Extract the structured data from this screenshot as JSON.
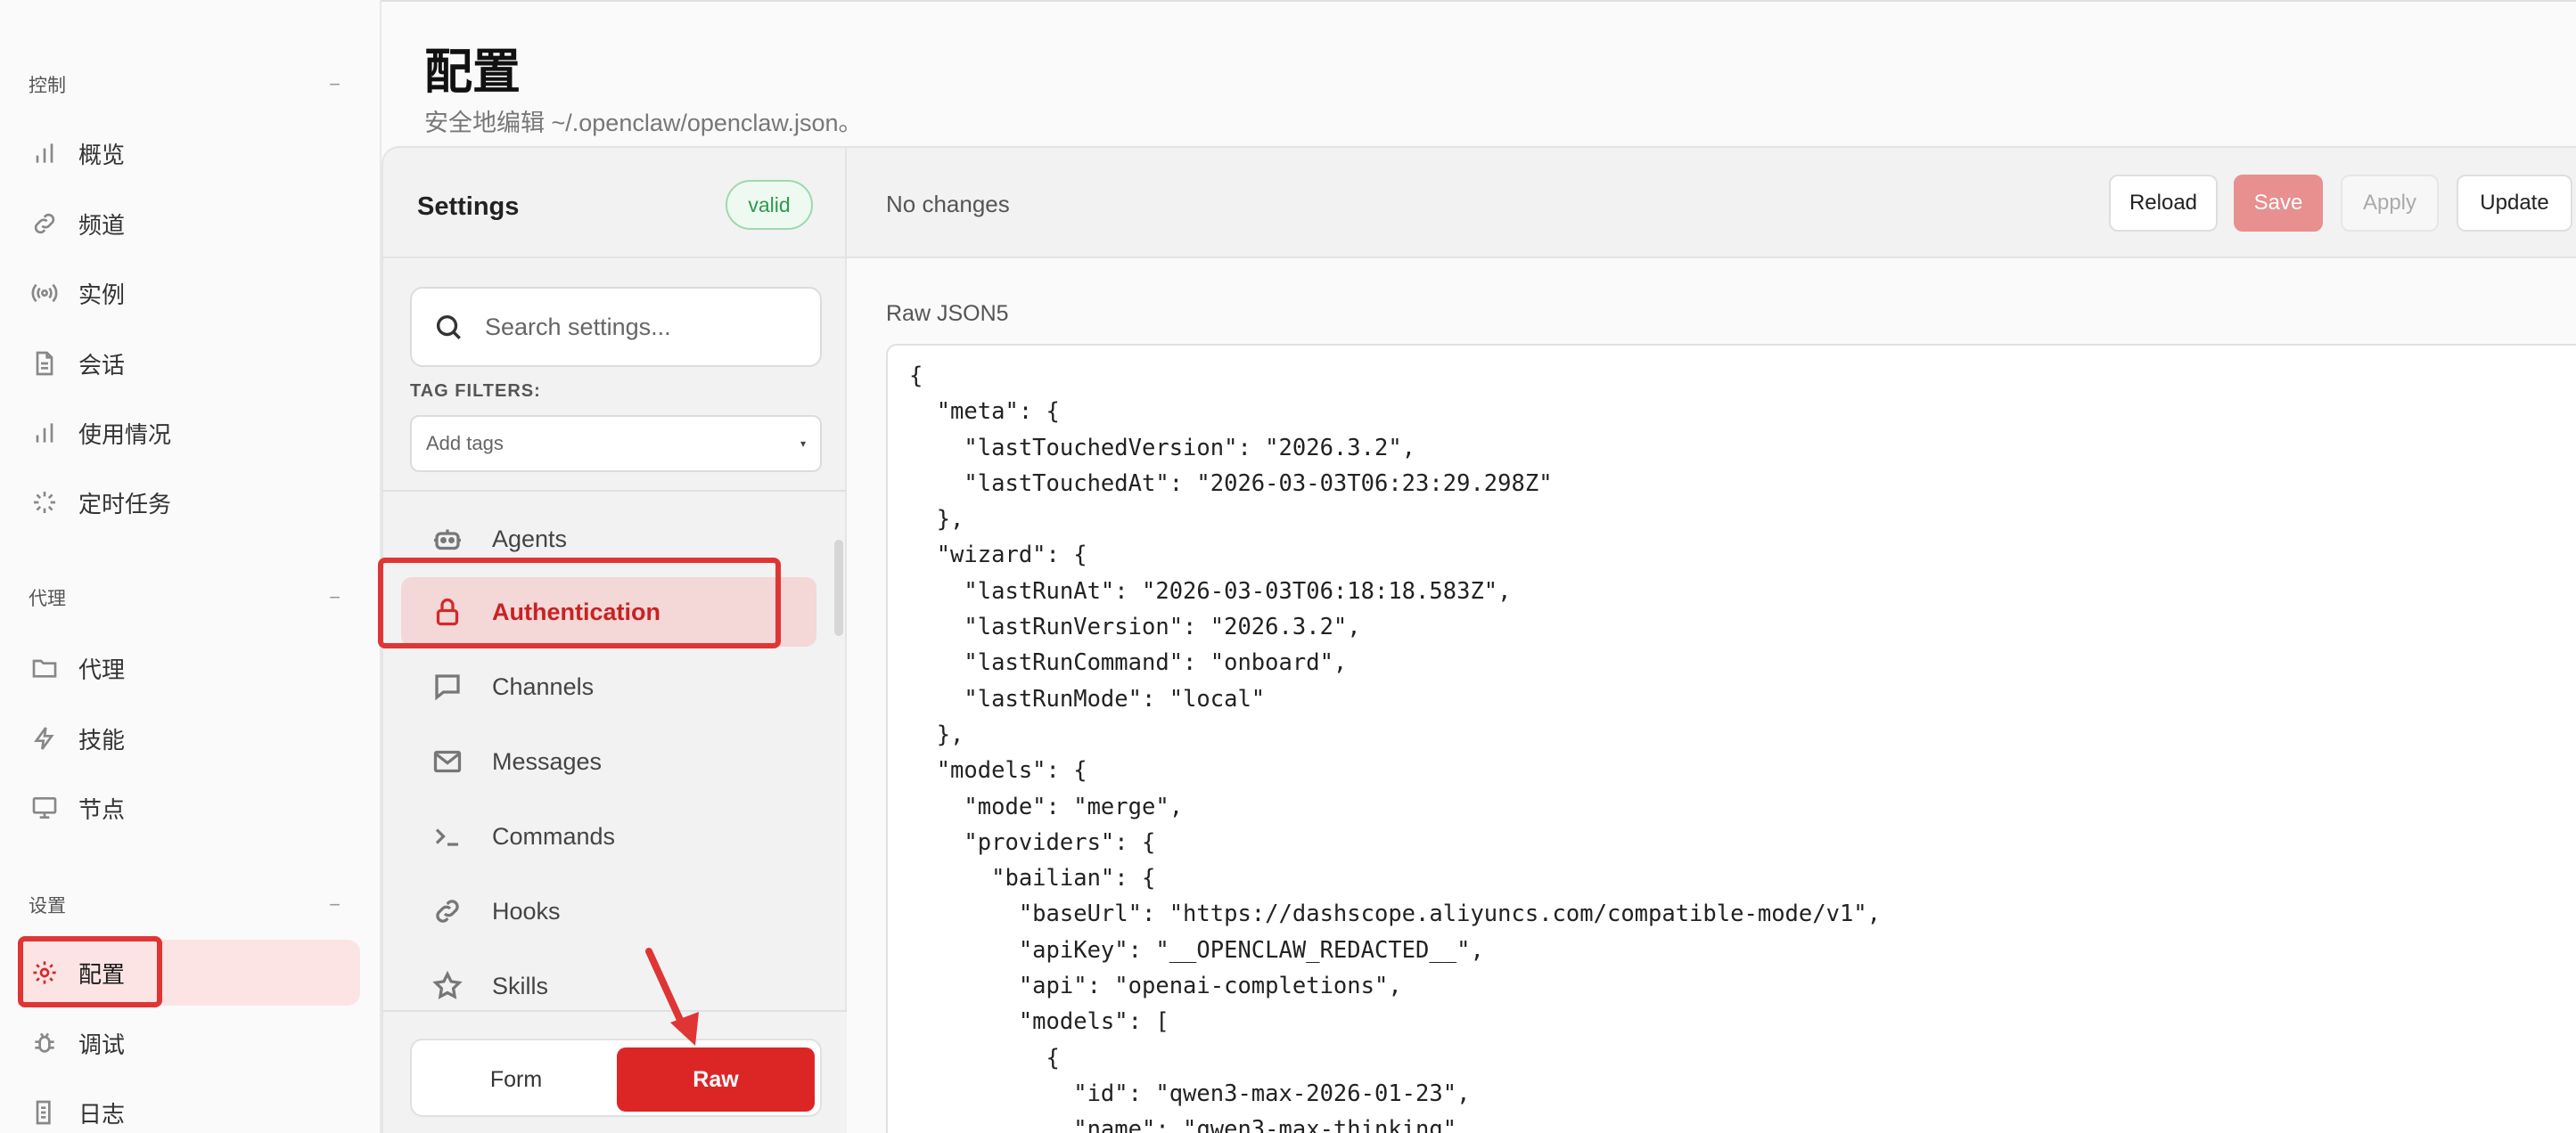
{
  "nav": {
    "groups": [
      {
        "title": "控制",
        "collapse": "−"
      },
      {
        "title": "代理",
        "collapse": "−"
      },
      {
        "title": "设置",
        "collapse": "−"
      }
    ],
    "items": [
      {
        "label": "概览",
        "icon": "bar-chart-icon"
      },
      {
        "label": "频道",
        "icon": "link-icon"
      },
      {
        "label": "实例",
        "icon": "radio-signal-icon"
      },
      {
        "label": "会话",
        "icon": "document-icon"
      },
      {
        "label": "使用情况",
        "icon": "bar-chart-icon"
      },
      {
        "label": "定时任务",
        "icon": "loader-icon"
      },
      {
        "label": "代理",
        "icon": "folder-icon"
      },
      {
        "label": "技能",
        "icon": "lightning-icon"
      },
      {
        "label": "节点",
        "icon": "monitor-icon"
      },
      {
        "label": "配置",
        "icon": "gear-icon",
        "active": true
      },
      {
        "label": "调试",
        "icon": "bug-icon"
      },
      {
        "label": "日志",
        "icon": "log-icon"
      }
    ]
  },
  "header": {
    "title": "配置",
    "subtitle": "安全地编辑 ~/.openclaw/openclaw.json。"
  },
  "settings": {
    "title": "Settings",
    "badge": "valid",
    "search_placeholder": "Search settings...",
    "tag_filters_label": "TAG FILTERS:",
    "tag_placeholder": "Add tags",
    "sections": [
      {
        "label": "Agents",
        "icon": "robot-icon"
      },
      {
        "label": "Authentication",
        "icon": "lock-icon",
        "active": true
      },
      {
        "label": "Channels",
        "icon": "chat-bubble-icon"
      },
      {
        "label": "Messages",
        "icon": "mail-icon"
      },
      {
        "label": "Commands",
        "icon": "terminal-icon"
      },
      {
        "label": "Hooks",
        "icon": "link-icon"
      },
      {
        "label": "Skills",
        "icon": "star-icon"
      }
    ],
    "mode_form": "Form",
    "mode_raw": "Raw"
  },
  "toolbar": {
    "status": "No changes",
    "reload": "Reload",
    "save": "Save",
    "apply": "Apply",
    "update": "Update"
  },
  "editor": {
    "label": "Raw JSON5",
    "content": "{\n  \"meta\": {\n    \"lastTouchedVersion\": \"2026.3.2\",\n    \"lastTouchedAt\": \"2026-03-03T06:23:29.298Z\"\n  },\n  \"wizard\": {\n    \"lastRunAt\": \"2026-03-03T06:18:18.583Z\",\n    \"lastRunVersion\": \"2026.3.2\",\n    \"lastRunCommand\": \"onboard\",\n    \"lastRunMode\": \"local\"\n  },\n  \"models\": {\n    \"mode\": \"merge\",\n    \"providers\": {\n      \"bailian\": {\n        \"baseUrl\": \"https://dashscope.aliyuncs.com/compatible-mode/v1\",\n        \"apiKey\": \"__OPENCLAW_REDACTED__\",\n        \"api\": \"openai-completions\",\n        \"models\": [\n          {\n            \"id\": \"qwen3-max-2026-01-23\",\n            \"name\": \"qwen3-max-thinking\""
  },
  "colors": {
    "accent": "#dc2626",
    "active_bg": "#fce4e4",
    "valid_green": "#2a9a4a",
    "annotation_red": "#e03535"
  }
}
